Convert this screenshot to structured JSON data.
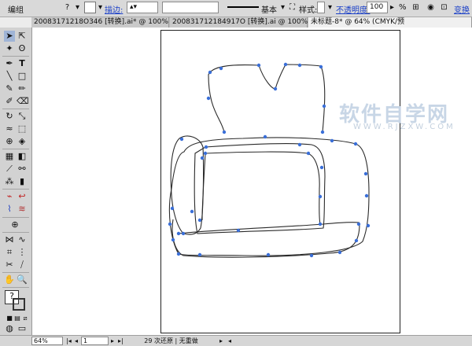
{
  "control_bar": {
    "mode_label": "编组",
    "stroke_label": "描边:",
    "style_label": "基本",
    "style2_label": "样式:",
    "opacity_label": "不透明度:",
    "opacity_value": "100",
    "percent": "%",
    "transform_label": "变换"
  },
  "tabs": [
    {
      "label": "20083171218O346 [转换].ai* @ 100% (CMYK/预览)"
    },
    {
      "label": "200831712184917O [转换].ai @ 100% (CMYK/预览)"
    },
    {
      "label": "未标题-8* @ 64% (CMYK/预"
    }
  ],
  "watermark": {
    "title": "软件自学网",
    "url": "WWW.RJZXW.COM"
  },
  "status": {
    "zoom": "64%",
    "page": "1",
    "message": "29 次还原 | 无重做"
  },
  "colors": {
    "anchor": "#3a6fd8",
    "path": "#2b2b2b"
  }
}
